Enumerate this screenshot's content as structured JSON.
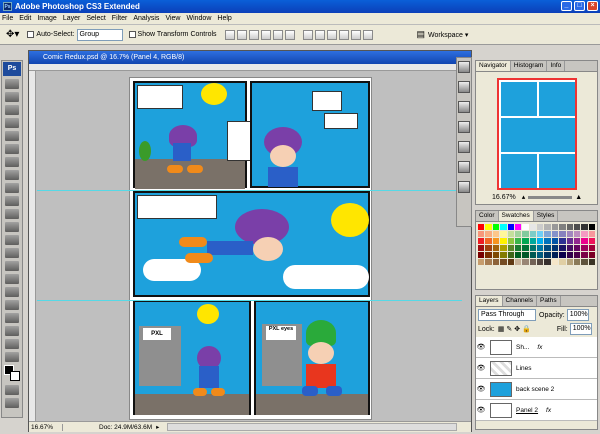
{
  "window": {
    "title": "Adobe Photoshop CS3 Extended",
    "app_icon": "Ps"
  },
  "menu": [
    "File",
    "Edit",
    "Image",
    "Layer",
    "Select",
    "Filter",
    "Analysis",
    "View",
    "Window",
    "Help"
  ],
  "options": {
    "auto_select_label": "Auto-Select:",
    "auto_select_value": "Group",
    "show_transform_label": "Show Transform Controls",
    "workspace_label": "Workspace ▾"
  },
  "document": {
    "title": "Comic Redux.psd @ 16.7% (Panel 4, RGB/8)",
    "zoom": "16.67%",
    "doc_info": "Doc: 24.9M/63.6M"
  },
  "navigator": {
    "tabs": [
      "Navigator",
      "Histogram",
      "Info"
    ],
    "zoom": "16.67%"
  },
  "swatches": {
    "tabs": [
      "Color",
      "Swatches",
      "Styles"
    ]
  },
  "layers": {
    "tabs": [
      "Layers",
      "Channels",
      "Paths"
    ],
    "blend_mode": "Pass Through",
    "opacity_label": "Opacity:",
    "opacity": "100%",
    "lock_label": "Lock:",
    "fill_label": "Fill:",
    "fill": "100%",
    "items": [
      {
        "name": "Sh..."
      },
      {
        "name": "Lines"
      },
      {
        "name": "back scene 2"
      },
      {
        "name": "Panel 2"
      }
    ]
  },
  "comic": {
    "sign_text": "PXL",
    "sign_text2": "PXL eyes"
  },
  "colors": {
    "sky": "#1ea1dc",
    "title_bar": "#0b50d0",
    "foreground": "#000000",
    "background": "#ffffff"
  },
  "swatch_colors": [
    "#ff0000",
    "#ffff00",
    "#00ff00",
    "#00ffff",
    "#0000ff",
    "#ff00ff",
    "#ffffff",
    "#e6e6e6",
    "#cccccc",
    "#b3b3b3",
    "#999999",
    "#808080",
    "#666666",
    "#4d4d4d",
    "#333333",
    "#000000",
    "#f7977a",
    "#f9ad81",
    "#fdc68a",
    "#fff79a",
    "#c4df9b",
    "#a2d39c",
    "#82ca9d",
    "#7bcdc8",
    "#6ecff6",
    "#7ea7d8",
    "#8493ca",
    "#8882be",
    "#a187be",
    "#bc8dbf",
    "#f49ac2",
    "#f6989d",
    "#ed1c24",
    "#f26522",
    "#f7941d",
    "#fff200",
    "#8dc63f",
    "#39b54a",
    "#00a651",
    "#00a99d",
    "#00aeef",
    "#0072bc",
    "#0054a6",
    "#2e3192",
    "#662d91",
    "#92278f",
    "#ec008c",
    "#ed145b",
    "#9e0b0f",
    "#a0410d",
    "#a36209",
    "#aba000",
    "#598527",
    "#1a7b30",
    "#007236",
    "#00746b",
    "#0076a3",
    "#004b80",
    "#003471",
    "#1b1464",
    "#440e62",
    "#630460",
    "#9e005d",
    "#9e0039",
    "#790000",
    "#7b2e00",
    "#7d4900",
    "#827b00",
    "#406618",
    "#005e20",
    "#005826",
    "#005952",
    "#005b7f",
    "#003663",
    "#002157",
    "#0d004c",
    "#32004b",
    "#4b0049",
    "#7b0046",
    "#7a0026",
    "#c69c6d",
    "#a67c52",
    "#8c6239",
    "#754c24",
    "#603913",
    "#c7b299",
    "#998675",
    "#736357",
    "#534741",
    "#362f2d",
    "#f5e6c8",
    "#e0cfa4",
    "#b5a27a",
    "#8a7a58",
    "#5e533c",
    "#3a3425"
  ]
}
